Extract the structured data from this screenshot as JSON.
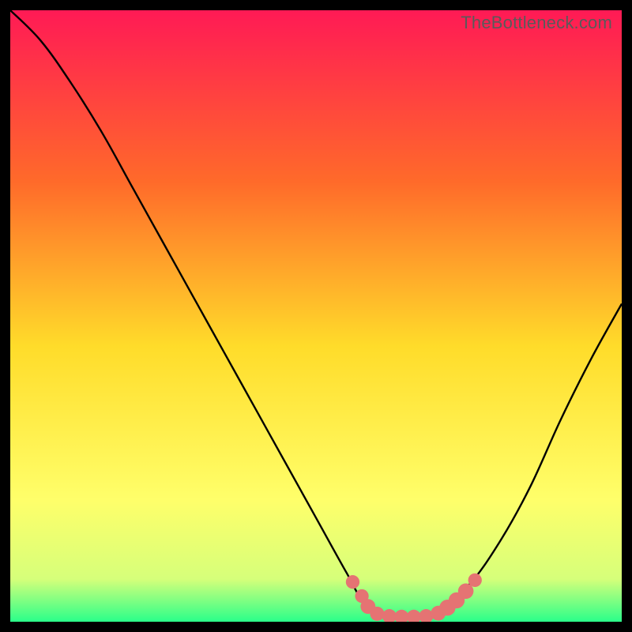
{
  "watermark": "TheBottleneck.com",
  "colors": {
    "gradient_top": "#ff1a55",
    "gradient_mid1": "#ff6a2a",
    "gradient_mid2": "#ffdc2a",
    "gradient_mid3": "#ffff6a",
    "gradient_mid4": "#d6ff7a",
    "gradient_bottom": "#2aff8a",
    "curve": "#000000",
    "marker_fill": "#e57373",
    "marker_stroke": "#d96060"
  },
  "chart_data": {
    "type": "line",
    "title": "",
    "xlabel": "",
    "ylabel": "",
    "xlim": [
      0,
      100
    ],
    "ylim": [
      0,
      100
    ],
    "series": [
      {
        "name": "bottleneck-curve",
        "x": [
          0,
          5,
          10,
          15,
          20,
          25,
          30,
          35,
          40,
          45,
          50,
          55,
          58,
          62,
          66,
          70,
          75,
          80,
          85,
          90,
          95,
          100
        ],
        "y": [
          100,
          95,
          88,
          80,
          71,
          62,
          53,
          44,
          35,
          26,
          17,
          8,
          3,
          1,
          1,
          2,
          6,
          13,
          22,
          33,
          43,
          52
        ]
      }
    ],
    "markers": [
      {
        "x": 56,
        "y": 6.5,
        "r": 1.2
      },
      {
        "x": 57.5,
        "y": 4.2,
        "r": 1.2
      },
      {
        "x": 58.5,
        "y": 2.5,
        "r": 1.4
      },
      {
        "x": 60,
        "y": 1.3,
        "r": 1.3
      },
      {
        "x": 62,
        "y": 0.9,
        "r": 1.3
      },
      {
        "x": 64,
        "y": 0.8,
        "r": 1.3
      },
      {
        "x": 66,
        "y": 0.8,
        "r": 1.3
      },
      {
        "x": 68,
        "y": 0.9,
        "r": 1.3
      },
      {
        "x": 70,
        "y": 1.4,
        "r": 1.4
      },
      {
        "x": 71.5,
        "y": 2.3,
        "r": 1.6
      },
      {
        "x": 73,
        "y": 3.5,
        "r": 1.6
      },
      {
        "x": 74.5,
        "y": 5.0,
        "r": 1.5
      },
      {
        "x": 76,
        "y": 6.8,
        "r": 1.2
      }
    ]
  }
}
